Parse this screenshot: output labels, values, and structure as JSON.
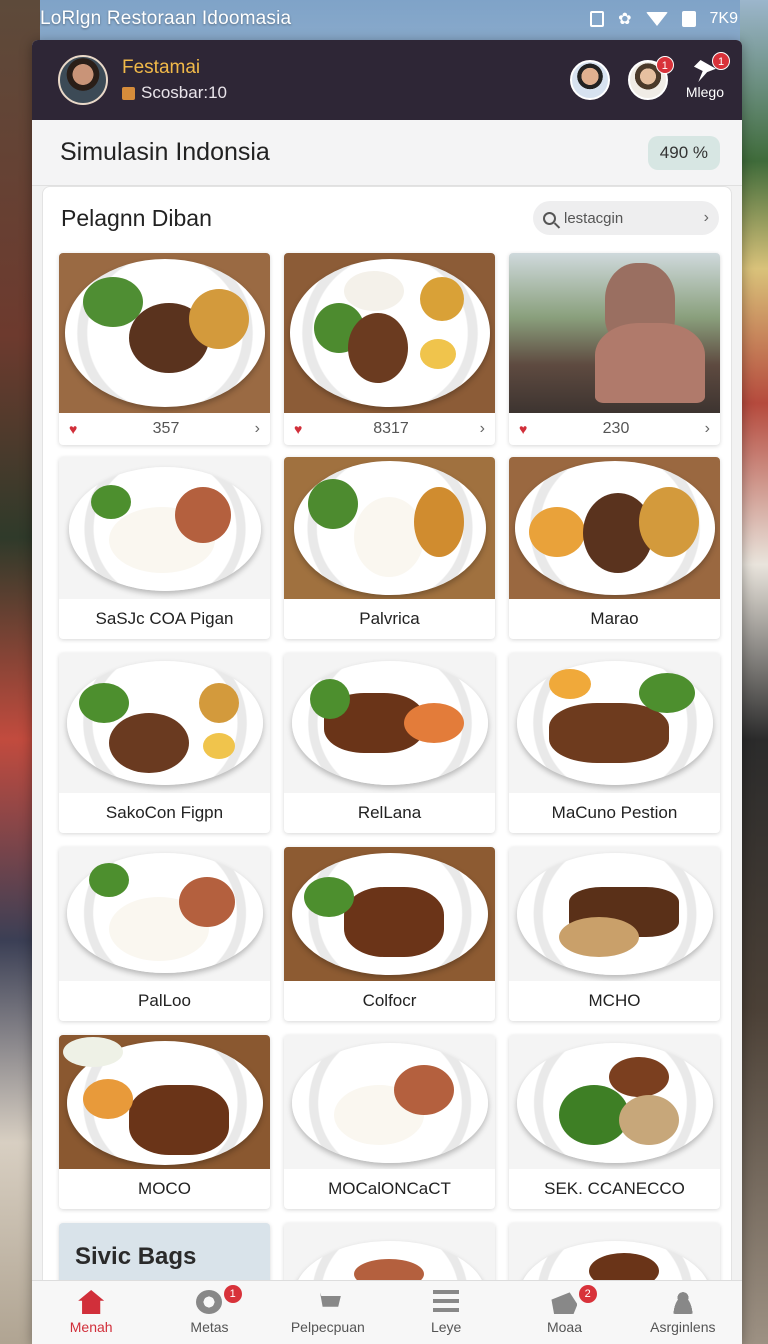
{
  "status_bar": {
    "title": "LoRlgn Restoraan Idoomasia",
    "time": "7K9"
  },
  "header": {
    "user_name": "Festamai",
    "user_sub": "Scosbar:10",
    "badge_count": "1",
    "notif_badge": "1",
    "notif_label": "Mlego"
  },
  "simulation": {
    "title": "Simulasin Indonsia",
    "percent": "490 %"
  },
  "panel": {
    "title": "Pelagnn Diban",
    "search_placeholder": "lestacgin"
  },
  "stat_cards": [
    {
      "count": "357"
    },
    {
      "count": "8317"
    },
    {
      "count": "230"
    }
  ],
  "menu_cards": [
    {
      "label": "SaSJc COA Pigan"
    },
    {
      "label": "Palvrica"
    },
    {
      "label": "Marao"
    },
    {
      "label": "SakoCon Figpn"
    },
    {
      "label": "RelLana"
    },
    {
      "label": "MaCuno Pestion"
    },
    {
      "label": "PalLoo"
    },
    {
      "label": "Colfocr"
    },
    {
      "label": "MCHO"
    },
    {
      "label": "MOCO"
    },
    {
      "label": "MOCalONCaCT"
    },
    {
      "label": "SEK. CCANECCO"
    }
  ],
  "promo": {
    "label": "Sivic Bags"
  },
  "bottom_nav": [
    {
      "label": "Menah",
      "icon": "home-icon"
    },
    {
      "label": "Metas",
      "icon": "discount-icon",
      "badge": "1"
    },
    {
      "label": "Pelpecpuan",
      "icon": "cart-icon"
    },
    {
      "label": "Leye",
      "icon": "menu-icon"
    },
    {
      "label": "Moaa",
      "icon": "delivery-icon",
      "badge": "2"
    },
    {
      "label": "Asrginlens",
      "icon": "account-icon"
    }
  ],
  "colors": {
    "accent": "#d12f3a",
    "header_bg": "#2e2636",
    "username": "#f1b949"
  }
}
